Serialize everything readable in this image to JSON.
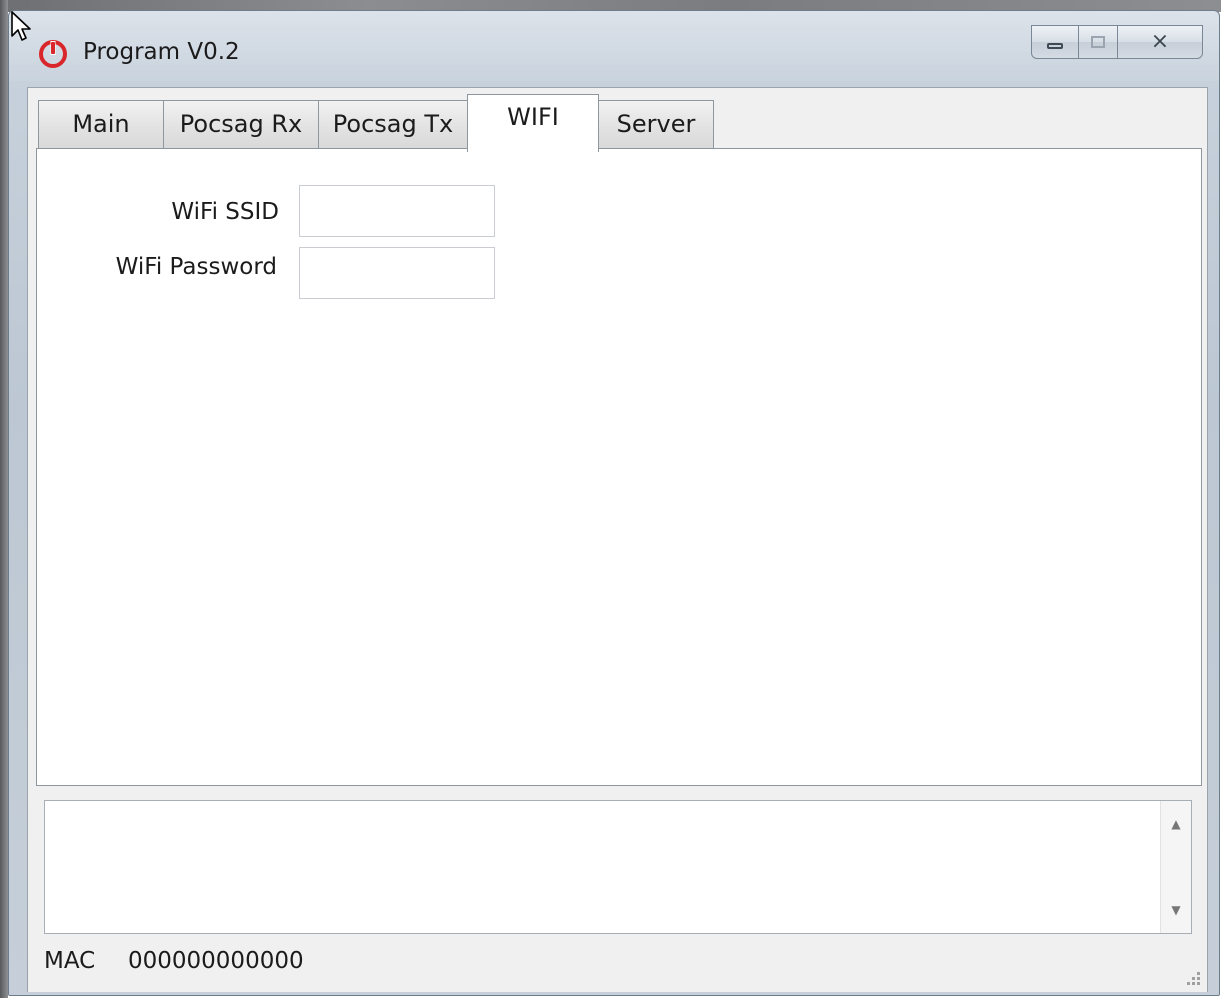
{
  "window": {
    "title": "Program V0.2",
    "app_icon": "power-icon",
    "controls": [
      "minimize-icon",
      "maximize-icon",
      "close-icon"
    ],
    "close_glyph": "⨯"
  },
  "tabs": [
    {
      "label": "Main",
      "active": false
    },
    {
      "label": "Pocsag Rx",
      "active": false
    },
    {
      "label": "Pocsag Tx",
      "active": false
    },
    {
      "label": "WIFI",
      "active": true
    },
    {
      "label": "Server",
      "active": false
    }
  ],
  "wifi": {
    "ssid_label": "WiFi SSID",
    "ssid_value": "",
    "password_label": "WiFi Password",
    "password_value": ""
  },
  "log": {
    "content": "",
    "scroll_up": "▲",
    "scroll_down": "▼"
  },
  "status": {
    "mac_label": "MAC",
    "mac_value": "000000000000"
  },
  "colors": {
    "app_icon_red": "#d9262b",
    "window_frame": "#c6cfd9",
    "client_bg": "#f0f0f0"
  }
}
